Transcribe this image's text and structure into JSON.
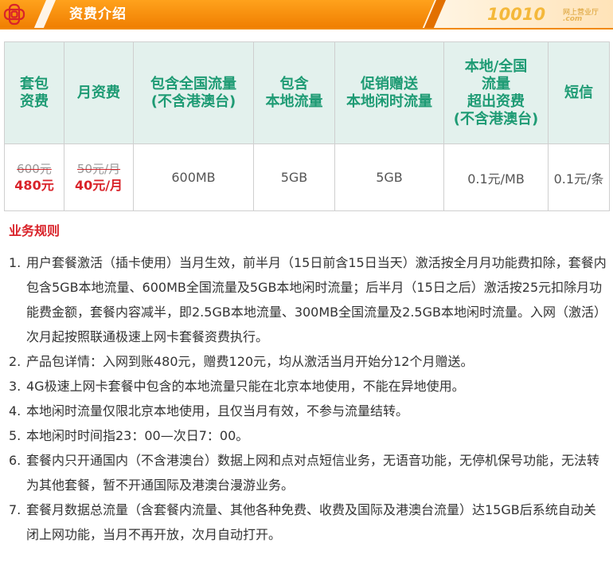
{
  "header": {
    "title": "资费介绍",
    "brand_number": "10010",
    "brand_subtitle": "网上营业厅",
    "brand_domain": ".com",
    "logo_icon": "china-unicom-knot-icon",
    "colors": {
      "banner_orange": "#f28a00",
      "banner_dark": "#d86f00",
      "brand_gold": "#f4b83a"
    }
  },
  "table": {
    "headers": [
      {
        "lines": [
          "套包",
          "资费"
        ]
      },
      {
        "lines": [
          "月资费"
        ]
      },
      {
        "lines": [
          "包含全国流量",
          "(不含港澳台)"
        ]
      },
      {
        "lines": [
          "包含",
          "本地流量"
        ]
      },
      {
        "lines": [
          "促销赠送",
          "本地闲时流量"
        ]
      },
      {
        "lines": [
          "本地/全国",
          "流量",
          "超出资费",
          "(不含港澳台)"
        ]
      },
      {
        "lines": [
          "短信"
        ]
      }
    ],
    "row": {
      "package_old": "600元",
      "package_new": "480元",
      "monthly_old": "50元/月",
      "monthly_new": "40元/月",
      "national_data": "600MB",
      "local_data": "5GB",
      "idle_data": "5GB",
      "overage": "0.1元/MB",
      "sms": "0.1元/条"
    },
    "colors": {
      "header_bg": "#e3f1ed",
      "header_text": "#1e9b74",
      "price_red": "#d9232a"
    }
  },
  "rules": {
    "title": "业务规则",
    "items": [
      {
        "num": "1.",
        "text": "用户套餐激活（插卡使用）当月生效，前半月（15日前含15日当天）激活按全月月功能费扣除，套餐内包含5GB本地流量、600MB全国流量及5GB本地闲时流量；后半月（15日之后）激活按25元扣除月功能费金额，套餐内容减半，即2.5GB本地流量、300MB全国流量及2.5GB本地闲时流量。入网（激活）次月起按照联通极速上网卡套餐资费执行。"
      },
      {
        "num": "2.",
        "text": "产品包详情：入网到账480元，赠费120元，均从激活当月开始分12个月赠送。"
      },
      {
        "num": "3.",
        "text": "4G极速上网卡套餐中包含的本地流量只能在北京本地使用，不能在异地使用。"
      },
      {
        "num": "4.",
        "text": "本地闲时流量仅限北京本地使用，且仅当月有效，不参与流量结转。"
      },
      {
        "num": "5.",
        "text": "本地闲时时间指23：00—次日7：00。"
      },
      {
        "num": "6.",
        "text": "套餐内只开通国内（不含港澳台）数据上网和点对点短信业务，无语音功能，无停机保号功能，无法转为其他套餐，暂不开通国际及港澳台漫游业务。"
      },
      {
        "num": "7.",
        "text": "套餐月数据总流量（含套餐内流量、其他各种免费、收费及国际及港澳台流量）达15GB后系统自动关闭上网功能，当月不再开放，次月自动打开。"
      }
    ]
  }
}
